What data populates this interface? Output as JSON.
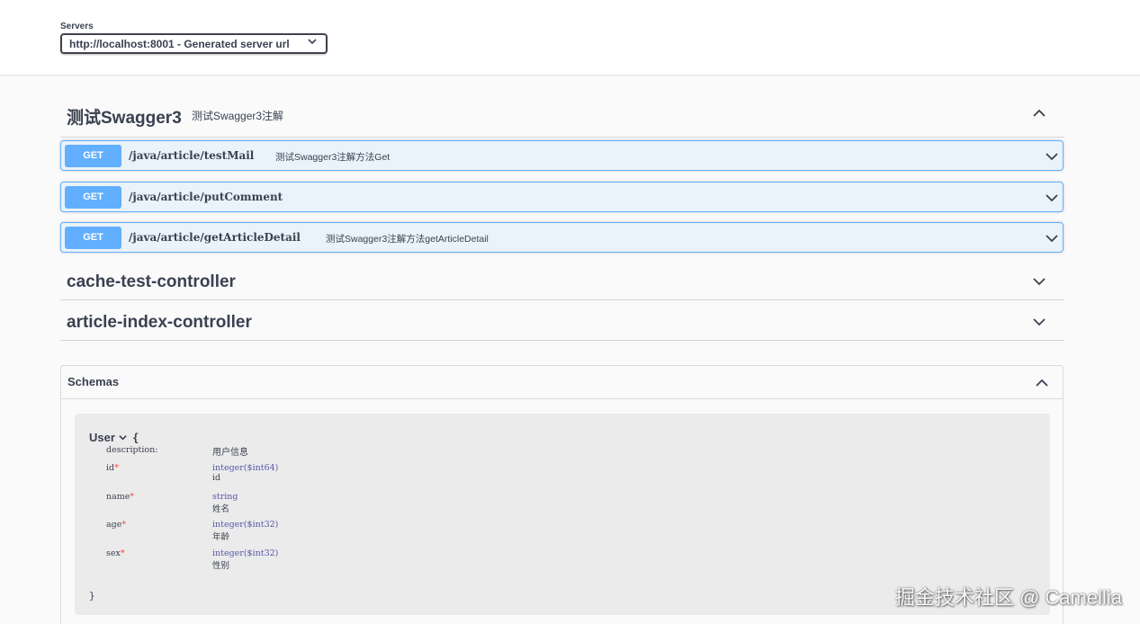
{
  "servers": {
    "label": "Servers",
    "selected": "http://localhost:8001 - Generated server url"
  },
  "tags": [
    {
      "name": "测试Swagger3",
      "description": "测试Swagger3注解",
      "expanded": true,
      "operations": [
        {
          "method": "GET",
          "path": "/java/article/testMail",
          "summary": "测试Swagger3注解方法Get"
        },
        {
          "method": "GET",
          "path": "/java/article/putComment",
          "summary": ""
        },
        {
          "method": "GET",
          "path": "/java/article/getArticleDetail",
          "summary": "测试Swagger3注解方法getArticleDetail"
        }
      ]
    },
    {
      "name": "cache-test-controller",
      "description": "",
      "expanded": false
    },
    {
      "name": "article-index-controller",
      "description": "",
      "expanded": false
    }
  ],
  "schemas": {
    "title": "Schemas",
    "model": {
      "name": "User",
      "open_brace": "{",
      "close_brace": "}",
      "description_key": "description:",
      "description_value": "用户信息",
      "properties": [
        {
          "key": "id",
          "required_mark": "*",
          "type": "integer($int64)",
          "desc": "id"
        },
        {
          "key": "name",
          "required_mark": "*",
          "type": "string",
          "desc": "姓名"
        },
        {
          "key": "age",
          "required_mark": "*",
          "type": "integer($int32)",
          "desc": "年龄"
        },
        {
          "key": "sex",
          "required_mark": "*",
          "type": "integer($int32)",
          "desc": "性别"
        }
      ]
    }
  },
  "watermark": "掘金技术社区 @ Camellia",
  "colors": {
    "get_method": "#61affe",
    "get_bg": "#eef6ff",
    "required": "#f93e3e",
    "text": "#3b4151"
  },
  "icons": {
    "expand": "chevron-down-icon",
    "collapse": "chevron-up-icon"
  }
}
